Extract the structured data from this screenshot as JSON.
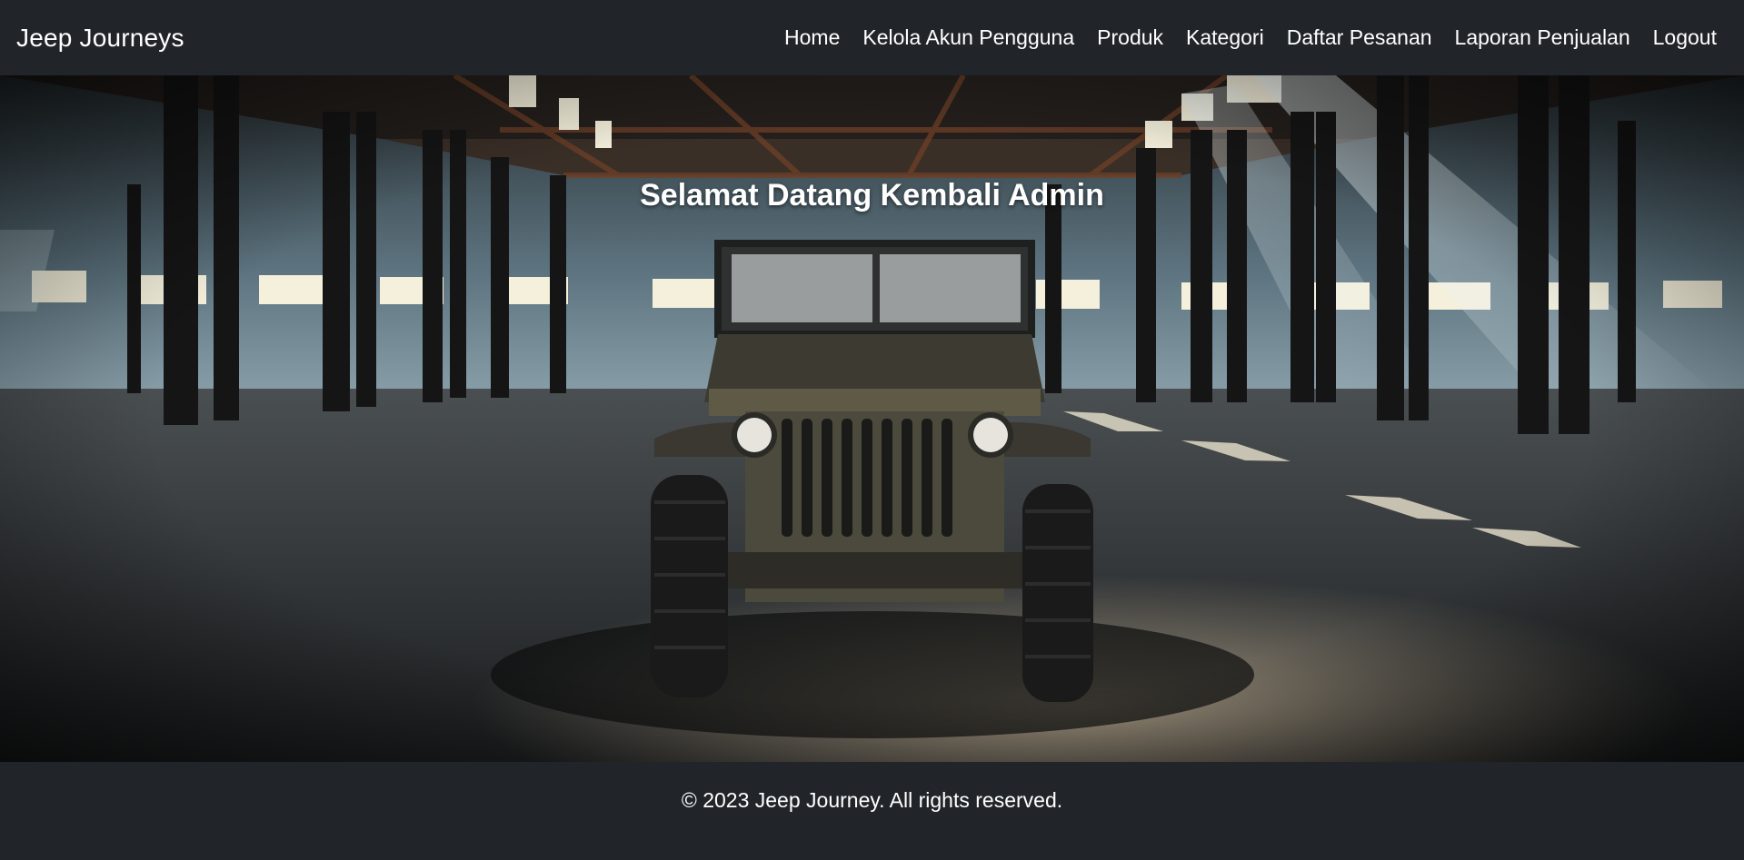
{
  "brand": "Jeep Journeys",
  "nav": {
    "home": "Home",
    "users": "Kelola Akun Pengguna",
    "products": "Produk",
    "categories": "Kategori",
    "orders": "Daftar Pesanan",
    "sales_report": "Laporan Penjualan",
    "logout": "Logout"
  },
  "hero": {
    "heading": "Selamat Datang Kembali Admin",
    "image": "vintage jeep parked in dim warehouse with sunbeams"
  },
  "footer": {
    "copyright": "© 2023 Jeep Journey. All rights reserved."
  },
  "colors": {
    "navbar_bg": "#212529",
    "text": "#ffffff"
  }
}
